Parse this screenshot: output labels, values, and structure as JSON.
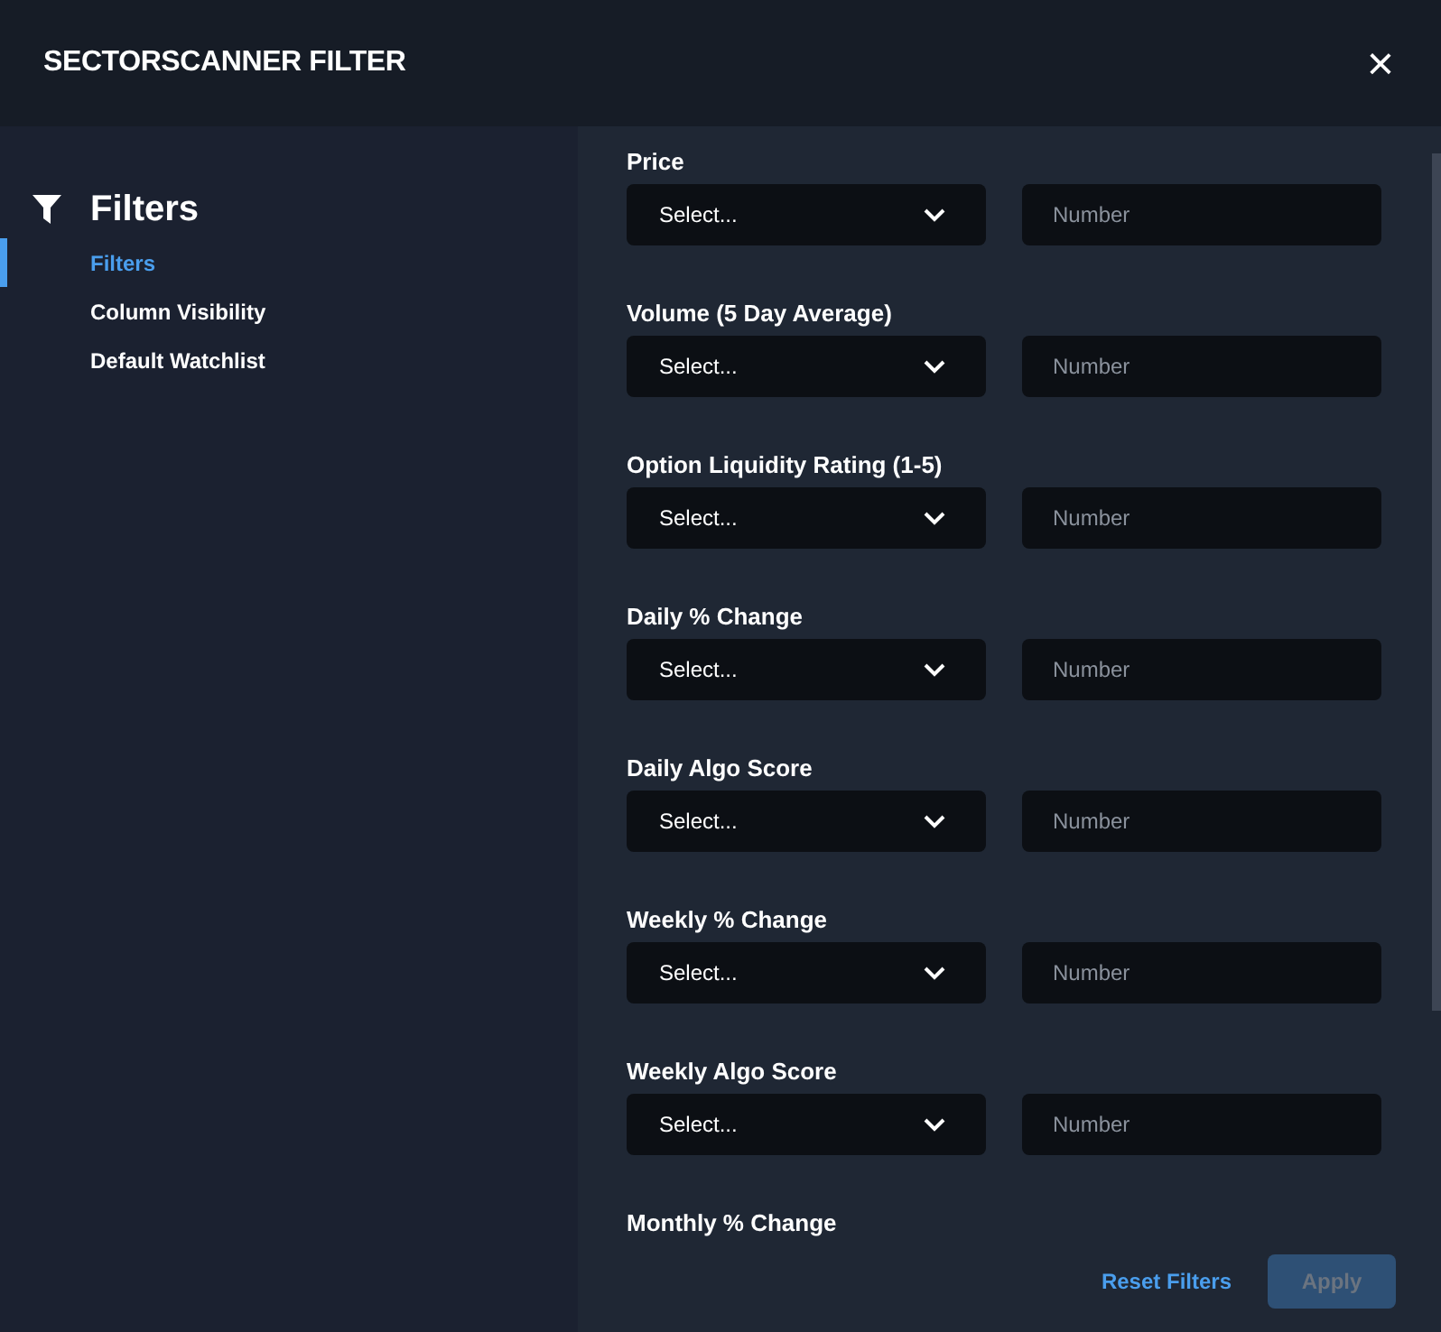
{
  "window": {
    "title": "SECTORSCANNER FILTER",
    "close": "×"
  },
  "sidebar": {
    "heading": "Filters",
    "items": [
      {
        "label": "Filters",
        "selected": true
      },
      {
        "label": "Column Visibility",
        "selected": false
      },
      {
        "label": "Default Watchlist",
        "selected": false
      }
    ]
  },
  "filters": [
    {
      "label": "Price",
      "select": "Select...",
      "placeholder": "Number"
    },
    {
      "label": "Volume (5 Day Average)",
      "select": "Select...",
      "placeholder": "Number"
    },
    {
      "label": "Option Liquidity Rating (1-5)",
      "select": "Select...",
      "placeholder": "Number"
    },
    {
      "label": "Daily % Change",
      "select": "Select...",
      "placeholder": "Number"
    },
    {
      "label": "Daily Algo Score",
      "select": "Select...",
      "placeholder": "Number"
    },
    {
      "label": "Weekly % Change",
      "select": "Select...",
      "placeholder": "Number"
    },
    {
      "label": "Weekly Algo Score",
      "select": "Select...",
      "placeholder": "Number"
    },
    {
      "label": "Monthly % Change"
    }
  ],
  "footer": {
    "reset": "Reset Filters",
    "apply": {
      "label": "Apply",
      "disabled": true
    }
  }
}
